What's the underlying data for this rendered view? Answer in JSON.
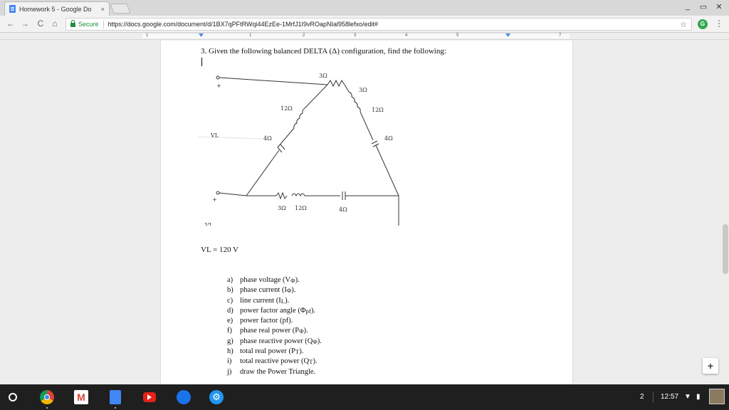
{
  "tab": {
    "title": "Homework 5 - Google Do",
    "close": "×"
  },
  "window": {
    "minimize": "_",
    "restore": "▭",
    "close": "✕"
  },
  "nav": {
    "back": "←",
    "forward": "→",
    "reload": "C",
    "home": "⌂"
  },
  "omnibox": {
    "secure_label": "Secure",
    "url": "https://docs.google.com/document/d/1BX7qPFtRWqi44EzEe-1MrfJ1I9vROapNIal958lefxo/edit#",
    "star": "☆"
  },
  "extension_label": "G",
  "menu_dots": "⋮",
  "ruler": {
    "ticks": [
      "1",
      "1",
      "2",
      "3",
      "4",
      "5",
      "7"
    ]
  },
  "document": {
    "question": "3. Given the following balanced DELTA (Δ) configuration, find the following:",
    "vl_line": "VL = 120 V",
    "parts": [
      {
        "letter": "a)",
        "text": "phase voltage (V",
        "sub": "Φ",
        "end": ")."
      },
      {
        "letter": "b)",
        "text": "phase current (I",
        "sub": "Φ",
        "end": ")."
      },
      {
        "letter": "c)",
        "text": "line current (I",
        "sub": "L",
        "end": ")."
      },
      {
        "letter": "d)",
        "text": "power factor angle (Φ",
        "sub": "pf",
        "end": ")."
      },
      {
        "letter": "e)",
        "text": "power factor (pf).",
        "sub": "",
        "end": ""
      },
      {
        "letter": "f)",
        "text": "phase real power (P",
        "sub": "Φ",
        "end": ")."
      },
      {
        "letter": "g)",
        "text": "phase reactive power (Q",
        "sub": "Φ",
        "end": ")."
      },
      {
        "letter": "h)",
        "text": "total real power (P",
        "sub": "T",
        "end": ")."
      },
      {
        "letter": "i)",
        "text": "total reactive power (Q",
        "sub": "T",
        "end": ")."
      },
      {
        "letter": "j)",
        "text": "draw the Power Triangle.",
        "sub": "",
        "end": ""
      }
    ]
  },
  "diagram": {
    "labels": {
      "plus_top": "+",
      "vl_top": "VL",
      "plus_bottom": "+",
      "vl_bottom": "VL",
      "minus_bottom": "-",
      "r_left": "3Ω",
      "r_right": "3Ω",
      "l_left": "12Ω",
      "l_right": "12Ω",
      "c_left": "4Ω",
      "c_right": "4Ω",
      "r_bottom": "3Ω",
      "l_bottom": "12Ω",
      "c_bottom": "4Ω"
    }
  },
  "fab_label": "+",
  "shelf": {
    "apps": [
      {
        "name": "chrome",
        "color": "#db4437"
      },
      {
        "name": "gmail",
        "color": "#ffffff"
      },
      {
        "name": "docs",
        "color": "#4285f4"
      },
      {
        "name": "youtube",
        "color": "#e62117"
      },
      {
        "name": "files",
        "color": "#1a73e8"
      },
      {
        "name": "settings",
        "color": "#2196f3"
      }
    ],
    "notification_count": "2",
    "time": "12:57",
    "wifi": "▼",
    "battery": "▮"
  }
}
